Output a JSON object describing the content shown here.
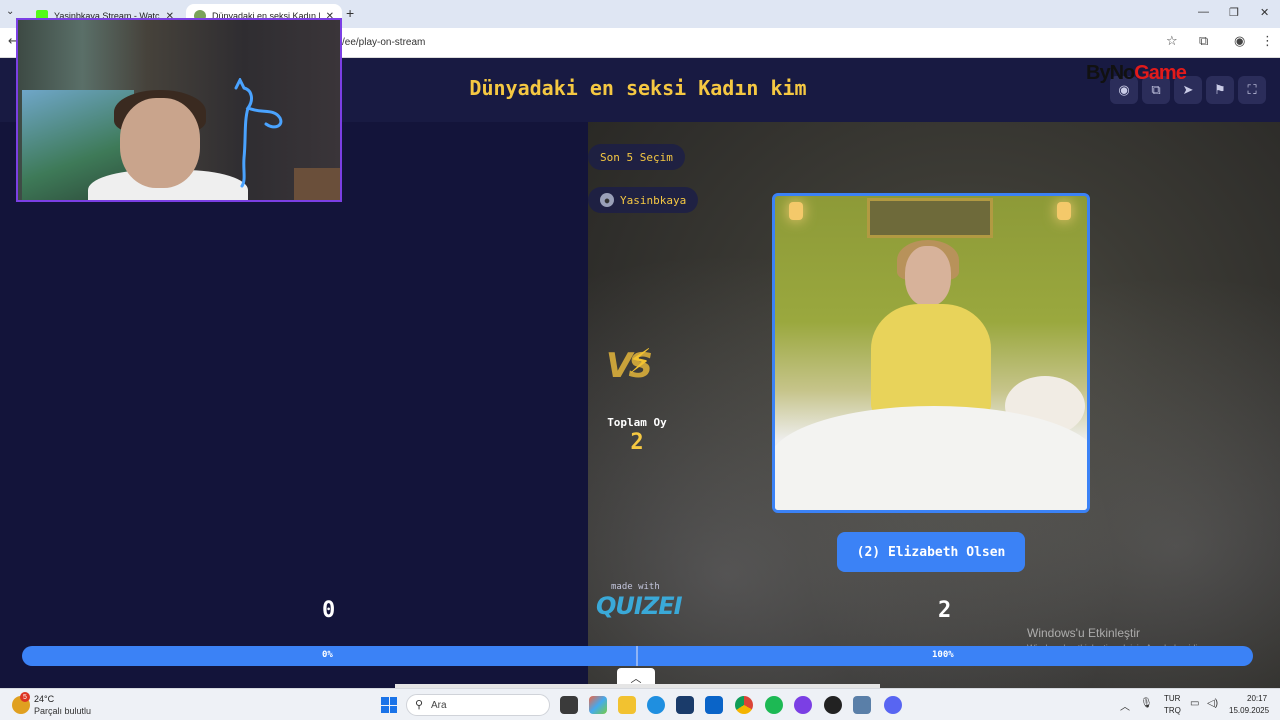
{
  "browser": {
    "tabs": [
      {
        "title": "Yasinbkaya Stream - Watch Live",
        "favicon_color": "#53fc18"
      },
      {
        "title": "Dünyadaki en seksi Kadın kim",
        "favicon_color": "#7aa35a"
      }
    ],
    "url_fragment": "/ee/play-on-stream"
  },
  "header": {
    "title": "Dünyadaki en seksi Kadın kim",
    "brand": {
      "part1": "ByNo",
      "part2": "Game"
    },
    "buttons": [
      "eye-icon",
      "copy-icon",
      "send-icon",
      "flag-icon",
      "fullscreen-icon"
    ]
  },
  "history": {
    "label": "Son 5 Seçim",
    "user": "Yasinbkaya"
  },
  "vs": {
    "text": "VS",
    "total_label": "Toplam Oy",
    "total_value": "2"
  },
  "choice": {
    "label": "(2) Elizabeth Olsen"
  },
  "scores": {
    "left": "0",
    "right": "2"
  },
  "footer": {
    "made_with": "made with",
    "brand": "QUIZEI"
  },
  "progress": {
    "left_label": "0%",
    "right_label": "100%",
    "left_fraction": 0.0,
    "right_fraction": 1.0
  },
  "windows_activation": {
    "title": "Windows'u Etkinleştir",
    "subtitle": "Windows'u etkinleştirmek için Ayarlar'a gidin."
  },
  "taskbar": {
    "weather_badge": "5",
    "temperature": "24°C",
    "condition": "Parçalı bulutlu",
    "search_placeholder": "Ara",
    "language_top": "TUR",
    "language_bottom": "TRQ",
    "time": "20:17",
    "date": "15.09.2025"
  },
  "colors": {
    "accent": "#3b82f6",
    "title_yellow": "#f5c842",
    "background": "#13143a"
  }
}
